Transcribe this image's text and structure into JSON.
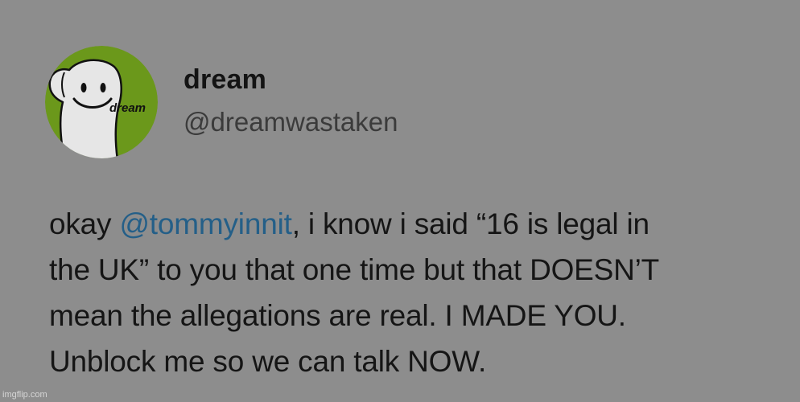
{
  "colors": {
    "background": "#8d8d8d",
    "avatar_bg": "#6b981b",
    "mention": "#245f88",
    "text": "#151515"
  },
  "avatar": {
    "icon": "dream-smiley-avatar",
    "label": "dream"
  },
  "user": {
    "display_name": "dream",
    "handle": "@dreamwastaken"
  },
  "tweet": {
    "line1_prefix": "okay ",
    "mention": "@tommyinnit",
    "line1_suffix": ", i know i said “16 is legal in",
    "line2": "the UK” to you that one time but that DOESN’T",
    "line3": "mean the allegations are real. I MADE YOU.",
    "line4": "Unblock me so we can talk NOW."
  },
  "watermark": "imgflip.com"
}
